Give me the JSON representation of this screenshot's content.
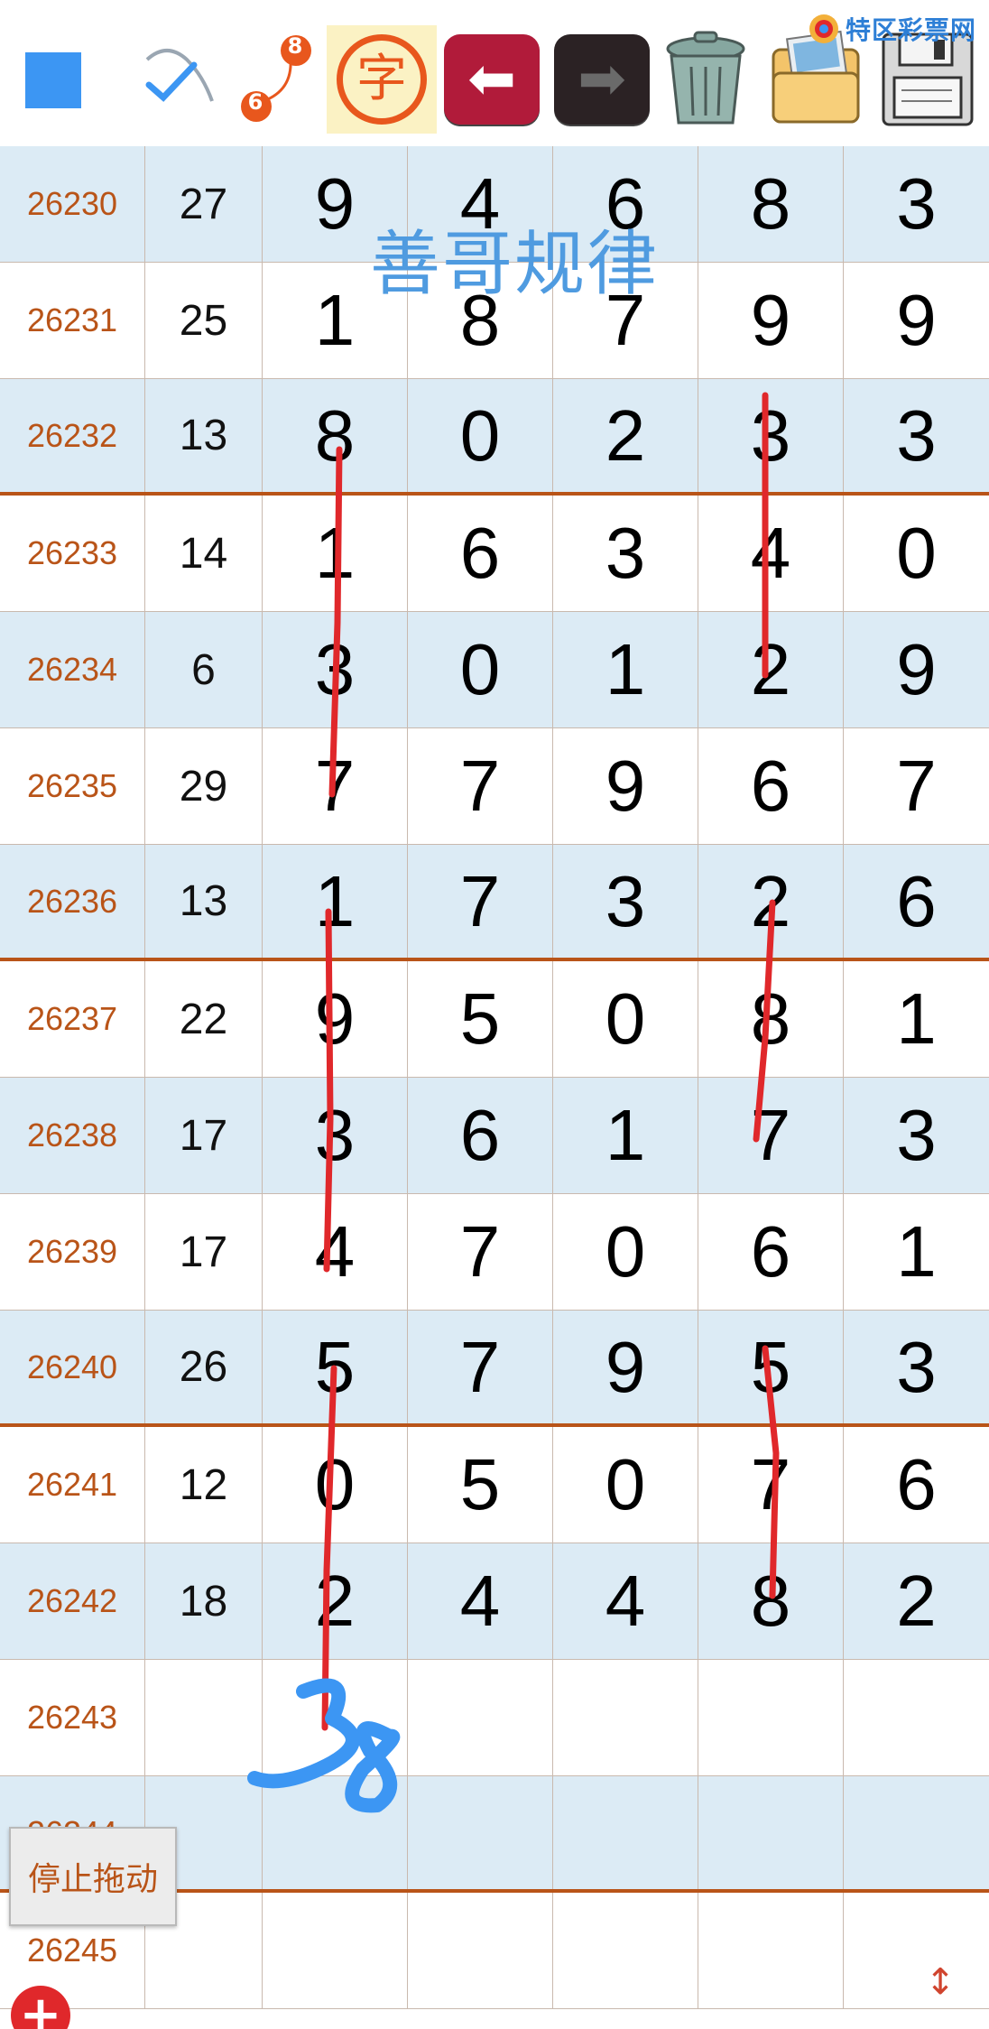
{
  "toolbar": {
    "items": [
      {
        "name": "color-square-button",
        "icon": "blue-square"
      },
      {
        "name": "draw-check-button",
        "icon": "pen-check-icon"
      },
      {
        "name": "sequence-button",
        "icon": "6-8-sequence-icon",
        "labels": [
          "6",
          "8"
        ]
      },
      {
        "name": "text-tool-button",
        "icon": "char-icon",
        "label": "字"
      },
      {
        "name": "undo-button",
        "icon": "arrow-left-icon"
      },
      {
        "name": "redo-button",
        "icon": "arrow-right-icon"
      },
      {
        "name": "delete-button",
        "icon": "trash-icon"
      },
      {
        "name": "images-button",
        "icon": "photo-folder-icon"
      },
      {
        "name": "save-button",
        "icon": "floppy-disk-icon"
      }
    ],
    "seq_from": "6",
    "seq_to": "8",
    "char_label": "字",
    "brand": "特区彩票网"
  },
  "watermark": "善哥规律",
  "rows": [
    {
      "issue": "26230",
      "sum": "27",
      "digits": [
        "9",
        "4",
        "6",
        "8",
        "3"
      ]
    },
    {
      "issue": "26231",
      "sum": "25",
      "digits": [
        "1",
        "8",
        "7",
        "9",
        "9"
      ]
    },
    {
      "issue": "26232",
      "sum": "13",
      "digits": [
        "8",
        "0",
        "2",
        "3",
        "3"
      ]
    },
    {
      "issue": "26233",
      "sum": "14",
      "digits": [
        "1",
        "6",
        "3",
        "4",
        "0"
      ]
    },
    {
      "issue": "26234",
      "sum": "6",
      "digits": [
        "3",
        "0",
        "1",
        "2",
        "9"
      ]
    },
    {
      "issue": "26235",
      "sum": "29",
      "digits": [
        "7",
        "7",
        "9",
        "6",
        "7"
      ]
    },
    {
      "issue": "26236",
      "sum": "13",
      "digits": [
        "1",
        "7",
        "3",
        "2",
        "6"
      ]
    },
    {
      "issue": "26237",
      "sum": "22",
      "digits": [
        "9",
        "5",
        "0",
        "8",
        "1"
      ]
    },
    {
      "issue": "26238",
      "sum": "17",
      "digits": [
        "3",
        "6",
        "1",
        "7",
        "3"
      ]
    },
    {
      "issue": "26239",
      "sum": "17",
      "digits": [
        "4",
        "7",
        "0",
        "6",
        "1"
      ]
    },
    {
      "issue": "26240",
      "sum": "26",
      "digits": [
        "5",
        "7",
        "9",
        "5",
        "3"
      ]
    },
    {
      "issue": "26241",
      "sum": "12",
      "digits": [
        "0",
        "5",
        "0",
        "7",
        "6"
      ]
    },
    {
      "issue": "26242",
      "sum": "18",
      "digits": [
        "2",
        "4",
        "4",
        "8",
        "2"
      ]
    },
    {
      "issue": "26243",
      "sum": "",
      "digits": [
        "",
        "",
        "",
        "",
        ""
      ]
    },
    {
      "issue": "26244",
      "sum": "",
      "digits": [
        "",
        "",
        "",
        "",
        ""
      ]
    },
    {
      "issue": "26245",
      "sum": "",
      "digits": [
        "",
        "",
        "",
        "",
        ""
      ]
    }
  ],
  "handwritten_note": "38",
  "stop_drag_label": "停止拖动",
  "add_label": "+",
  "colors": {
    "issue_text": "#b95418",
    "row_shade": "#dcebf5",
    "separator": "#b95418",
    "red_mark": "#e0282b",
    "blue_ink": "#3c96f3",
    "watermark": "#4f9be0"
  }
}
